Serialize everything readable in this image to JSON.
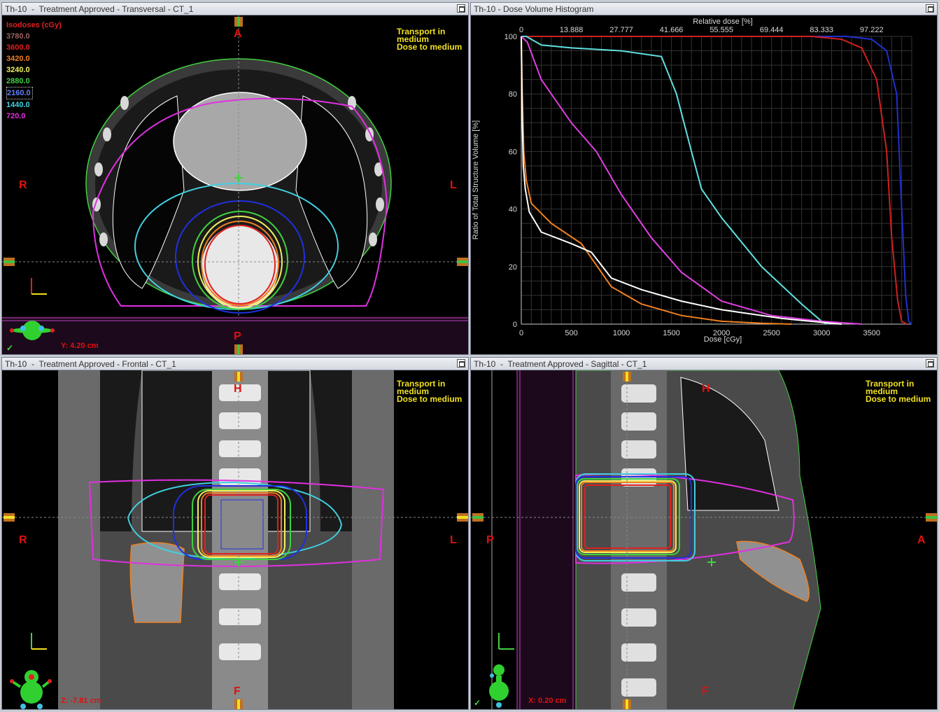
{
  "panes": {
    "transversal": {
      "title": "Th-10  -  Treatment Approved - Transversal - CT_1",
      "orient": {
        "top": "A",
        "bottom": "P",
        "left": "R",
        "right": "L"
      },
      "transport": [
        "Transport in",
        "medium",
        "Dose to medium"
      ],
      "coord": "Y: 4.20 cm"
    },
    "dvh": {
      "title": "Th-10 - Dose Volume Histogram"
    },
    "frontal": {
      "title": "Th-10  -  Treatment Approved - Frontal - CT_1",
      "orient": {
        "top": "H",
        "bottom": "F",
        "left": "R",
        "right": "L"
      },
      "transport": [
        "Transport in",
        "medium",
        "Dose to medium"
      ],
      "coord": "Z: -7.81 cm"
    },
    "sagittal": {
      "title": "Th-10  -  Treatment Approved - Sagittal - CT_1",
      "orient": {
        "top": "H",
        "bottom": "F",
        "left": "P",
        "right": "A"
      },
      "transport": [
        "Transport in",
        "medium",
        "Dose to medium"
      ],
      "coord": "X: 0.20 cm"
    }
  },
  "isodoses": {
    "header": "Isodoses (cGy)",
    "levels": [
      {
        "value": "3780.0",
        "color": "#a06060"
      },
      {
        "value": "3600.0",
        "color": "#e02020"
      },
      {
        "value": "3420.0",
        "color": "#f08020"
      },
      {
        "value": "3240.0",
        "color": "#f0f060"
      },
      {
        "value": "2880.0",
        "color": "#40d040"
      },
      {
        "value": "2160.0",
        "color": "#2030e0"
      },
      {
        "value": "1440.0",
        "color": "#40d0e0"
      },
      {
        "value": "720.0",
        "color": "#e030e0"
      }
    ]
  },
  "chart_data": {
    "type": "line",
    "title": "",
    "xlabel": "Dose [cGy]",
    "ylabel": "Ratio of Total Structure Volume [%]",
    "x2label": "Relative dose [%]",
    "xlim": [
      0,
      3900
    ],
    "ylim": [
      0,
      100
    ],
    "x_ticks": [
      0,
      500,
      1000,
      1500,
      2000,
      2500,
      3000,
      3500
    ],
    "y_ticks": [
      0,
      20,
      40,
      60,
      80,
      100
    ],
    "x2_ticks": [
      "0",
      "13.888",
      "27.777",
      "41.666",
      "55.555",
      "69.444",
      "83.333",
      "97.222"
    ],
    "grid": true,
    "series": [
      {
        "color": "#2030d0",
        "x": [
          0,
          2900,
          3250,
          3500,
          3650,
          3750,
          3800,
          3840,
          3870,
          3900
        ],
        "y": [
          100,
          100,
          100,
          99,
          95,
          80,
          40,
          10,
          1,
          0
        ]
      },
      {
        "color": "#d02020",
        "x": [
          0,
          2900,
          3200,
          3400,
          3550,
          3650,
          3700,
          3760,
          3800,
          3850
        ],
        "y": [
          100,
          100,
          99,
          96,
          85,
          60,
          30,
          8,
          1,
          0
        ]
      },
      {
        "color": "#60e0e0",
        "x": [
          0,
          50,
          100,
          200,
          500,
          1000,
          1400,
          1550,
          1700,
          1800,
          2000,
          2400,
          2800,
          3000,
          3050
        ],
        "y": [
          100,
          100,
          99,
          97,
          96,
          95,
          93,
          80,
          60,
          47,
          37,
          20,
          7,
          1,
          0
        ]
      },
      {
        "color": "#e040e0",
        "x": [
          0,
          30,
          60,
          200,
          500,
          750,
          1000,
          1300,
          1600,
          2000,
          2500,
          3000,
          3400
        ],
        "y": [
          100,
          99,
          98,
          85,
          70,
          60,
          45,
          30,
          18,
          8,
          3,
          1,
          0
        ]
      },
      {
        "color": "#f08020",
        "x": [
          0,
          10,
          25,
          50,
          100,
          300,
          600,
          900,
          1200,
          1600,
          2000,
          2400,
          2700
        ],
        "y": [
          100,
          80,
          60,
          50,
          42,
          35,
          28,
          13,
          7,
          3,
          1,
          0.3,
          0
        ]
      },
      {
        "color": "#ffffff",
        "x": [
          0,
          10,
          20,
          40,
          80,
          200,
          500,
          700,
          900,
          1200,
          1600,
          2000,
          2600,
          3100,
          3200
        ],
        "y": [
          100,
          70,
          55,
          47,
          39,
          32,
          28,
          25,
          16,
          12,
          8,
          5,
          2,
          0.3,
          0
        ]
      }
    ]
  }
}
